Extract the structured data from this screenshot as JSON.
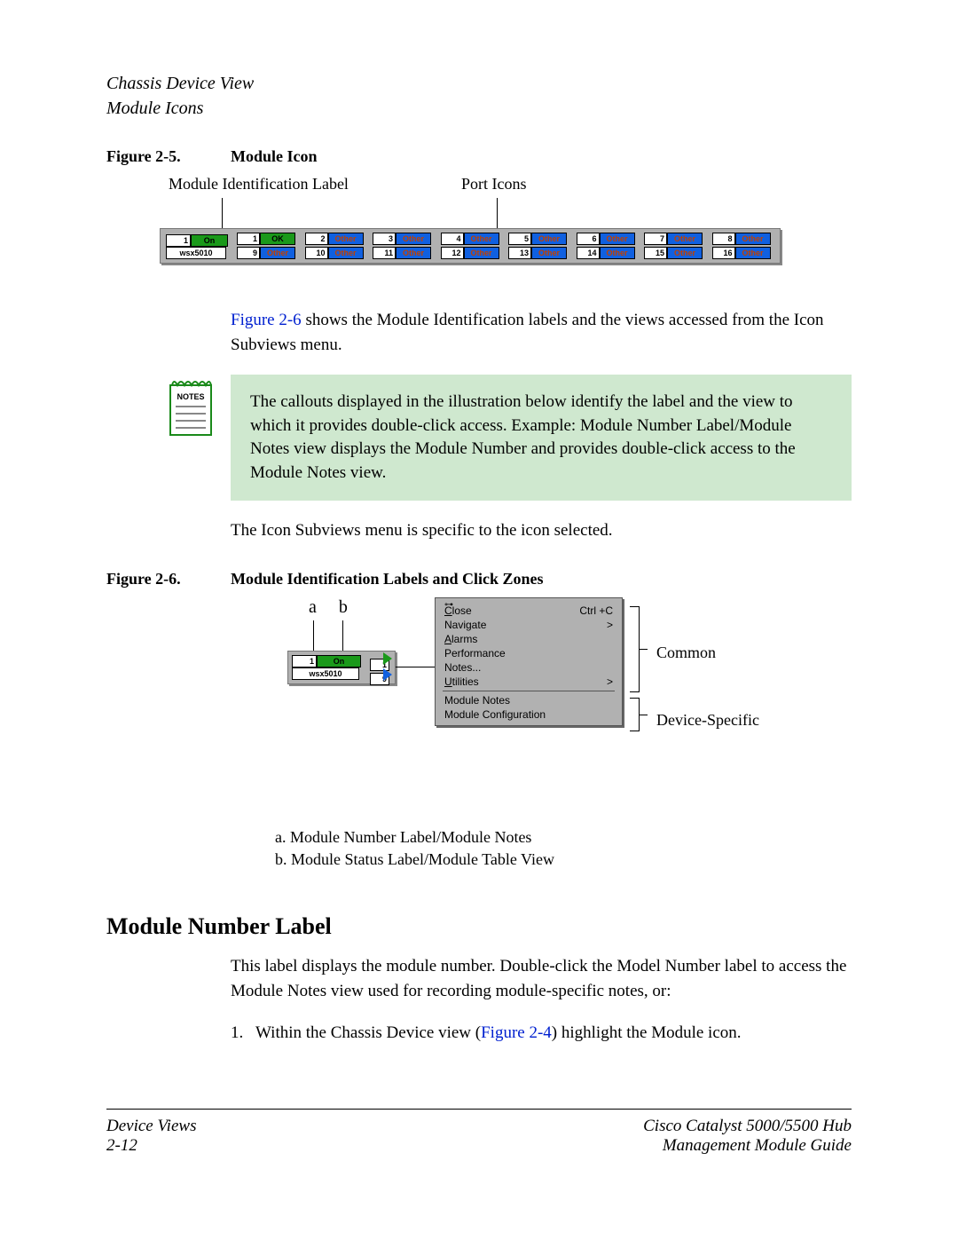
{
  "header": {
    "line1": "Chassis Device View",
    "line2": "Module Icons"
  },
  "figure25": {
    "num": "Figure 2-5.",
    "title": "Module Icon",
    "callout1": "Module Identification Label",
    "callout2": "Port Icons",
    "module": {
      "num": "1",
      "status": "On",
      "model": "wsx5010"
    },
    "ports_row1": [
      {
        "n": "1",
        "label": "OK",
        "cls": "port-ok"
      },
      {
        "n": "2",
        "label": "Other",
        "cls": "port-other"
      },
      {
        "n": "3",
        "label": "Other",
        "cls": "port-other"
      },
      {
        "n": "4",
        "label": "Other",
        "cls": "port-other"
      },
      {
        "n": "5",
        "label": "Other",
        "cls": "port-other"
      },
      {
        "n": "6",
        "label": "Other",
        "cls": "port-other"
      },
      {
        "n": "7",
        "label": "Other",
        "cls": "port-other"
      },
      {
        "n": "8",
        "label": "Other",
        "cls": "port-other"
      }
    ],
    "ports_row2": [
      {
        "n": "9",
        "label": "Other",
        "cls": "port-other"
      },
      {
        "n": "10",
        "label": "Other",
        "cls": "port-other"
      },
      {
        "n": "11",
        "label": "Other",
        "cls": "port-other"
      },
      {
        "n": "12",
        "label": "Other",
        "cls": "port-other"
      },
      {
        "n": "13",
        "label": "Other",
        "cls": "port-other"
      },
      {
        "n": "14",
        "label": "Other",
        "cls": "port-other"
      },
      {
        "n": "15",
        "label": "Other",
        "cls": "port-other"
      },
      {
        "n": "16",
        "label": "Other",
        "cls": "port-other"
      }
    ]
  },
  "para1_pre": "",
  "para1_link": "Figure 2-6",
  "para1_post": " shows the Module Identification labels and the views accessed from the Icon Subviews menu.",
  "notes_label": "NOTES",
  "notes_text": "The callouts displayed in the illustration below identify the label and the view to which it provides double-click access. Example: Module Number Label/Module Notes view displays the Module Number and provides double-click access to the Module Notes view.",
  "para2": "The Icon Subviews menu is specific to the icon selected.",
  "figure26": {
    "num": "Figure 2-6.",
    "title": "Module Identification Labels and Click Zones",
    "a": "a",
    "b": "b",
    "module": {
      "num": "1",
      "status": "On",
      "model": "wsx5010"
    },
    "small_ports": [
      "1",
      "9"
    ],
    "menu": {
      "close": "Close",
      "close_key": "Ctrl +C",
      "navigate": "Navigate",
      "alarms": "Alarms",
      "performance": "Performance",
      "notes": "Notes...",
      "utilities": "Utilities",
      "mod_notes": "Module Notes",
      "mod_config": "Module Configuration"
    },
    "right_common": "Common",
    "right_dev": "Device-Specific",
    "legend_a": "a.  Module Number Label/Module Notes",
    "legend_b": "b.  Module Status Label/Module Table View"
  },
  "section_h2": "Module Number Label",
  "section_p": "This label displays the module number. Double-click the Model Number label to access the Module Notes view used for recording module-specific notes, or:",
  "step1_pre": "Within the Chassis Device view (",
  "step1_link": "Figure 2-4",
  "step1_post": ") highlight the Module icon.",
  "step1_n": "1.",
  "footer": {
    "l1": "Device Views",
    "l2": "2-12",
    "r1": "Cisco Catalyst 5000/5500 Hub",
    "r2": "Management Module Guide"
  }
}
